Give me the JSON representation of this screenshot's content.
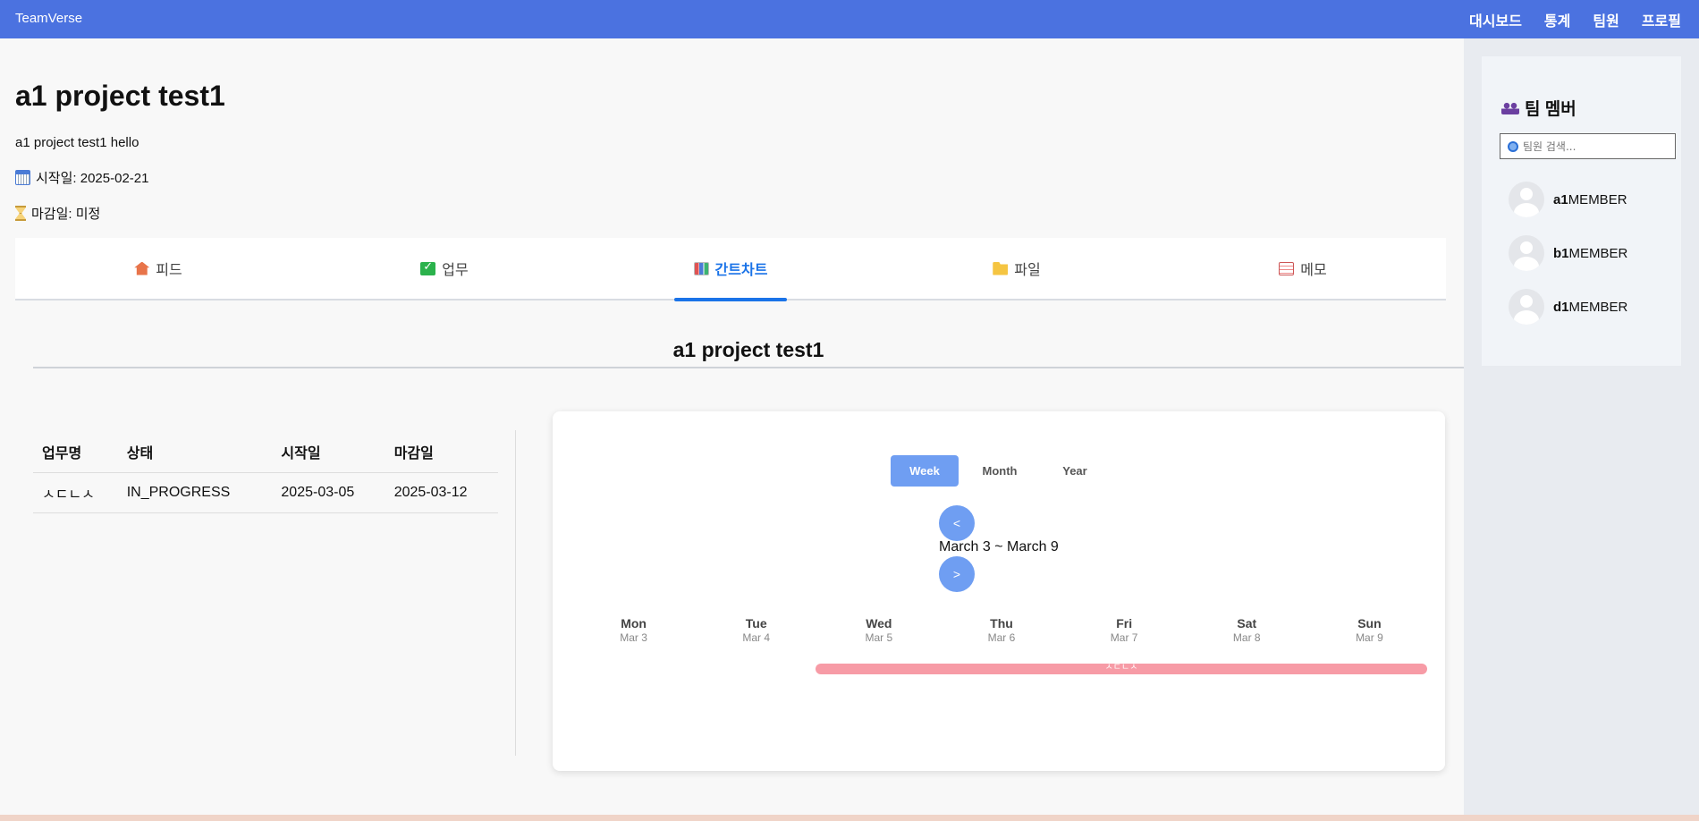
{
  "app": {
    "brand": "TeamVerse"
  },
  "nav": [
    "대시보드",
    "통계",
    "팀원",
    "프로필"
  ],
  "project": {
    "title": "a1 project test1",
    "description": "a1 project test1 hello",
    "start": "시작일: 2025-02-21",
    "due": "마감일: 미정"
  },
  "tabs": [
    {
      "label": "피드",
      "icon": "home-icon"
    },
    {
      "label": "업무",
      "icon": "check-icon"
    },
    {
      "label": "간트차트",
      "icon": "chart-icon",
      "active": true
    },
    {
      "label": "파일",
      "icon": "folder-icon"
    },
    {
      "label": "메모",
      "icon": "memo-icon"
    }
  ],
  "section_title": "a1 project test1",
  "task_table": {
    "headers": [
      "업무명",
      "상태",
      "시작일",
      "마감일"
    ],
    "rows": [
      [
        "ㅅㄷㄴㅅ",
        "IN_PROGRESS",
        "2025-03-05",
        "2025-03-12"
      ]
    ]
  },
  "gantt": {
    "views": [
      "Week",
      "Month",
      "Year"
    ],
    "active_view": "Week",
    "prev": "<",
    "next": ">",
    "range": "March 3 ~ March 9",
    "days": [
      {
        "name": "Mon",
        "date": "Mar 3"
      },
      {
        "name": "Tue",
        "date": "Mar 4"
      },
      {
        "name": "Wed",
        "date": "Mar 5"
      },
      {
        "name": "Thu",
        "date": "Mar 6"
      },
      {
        "name": "Fri",
        "date": "Mar 7"
      },
      {
        "name": "Sat",
        "date": "Mar 8"
      },
      {
        "name": "Sun",
        "date": "Mar 9"
      }
    ],
    "bar_label": "ㅅㄷㄴㅅ",
    "bar_color": "#f79ba6"
  },
  "team": {
    "title": "팀 멤버",
    "search_placeholder": "팀원 검색...",
    "members": [
      {
        "id": "a1",
        "role": "MEMBER"
      },
      {
        "id": "b1",
        "role": "MEMBER"
      },
      {
        "id": "d1",
        "role": "MEMBER"
      }
    ]
  },
  "colors": {
    "topbar": "#4b72e0",
    "accent": "#1a73e8",
    "button": "#6f9ef2"
  }
}
